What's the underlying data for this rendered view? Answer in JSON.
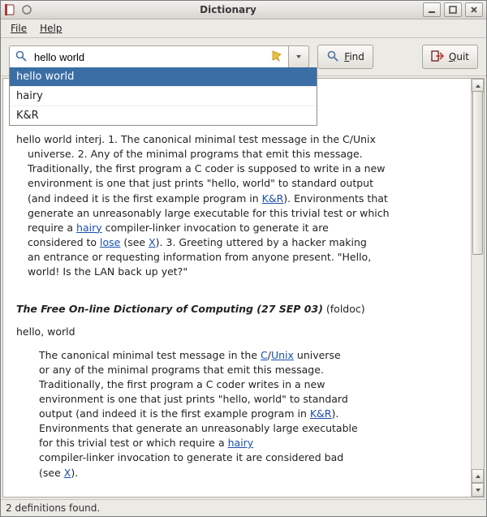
{
  "window": {
    "title": "Dictionary"
  },
  "menu": {
    "file": "File",
    "help": "Help"
  },
  "search": {
    "value": "hello world"
  },
  "buttons": {
    "find": "Find",
    "quit": "Quit"
  },
  "dropdown": {
    "items": [
      "hello world",
      "hairy",
      "K&R"
    ]
  },
  "def1": {
    "head": "hello world interj. 1. The canonical minimal test message in the C/Unix",
    "l2": "universe. 2. Any of the minimal programs that emit this message.",
    "l3": "Traditionally, the first program a C coder is supposed to write in a new",
    "l4a": "environment is one that just prints \"hello, world\" to standard output",
    "l4b": "(and indeed it is the first example program in ",
    "link_kr": "K&R",
    "l4c": "). Environments that",
    "l5": "generate an unreasonably large executable for this trivial test or which",
    "l6a": "require a ",
    "link_hairy": "hairy",
    "l6b": " compiler-linker invocation to generate it are",
    "l7a": "considered to ",
    "link_lose": "lose",
    "l7b": " (see ",
    "link_x": "X",
    "l7c": "). 3. Greeting uttered by a hacker making",
    "l8": "an entrance or requesting information from anyone present. \"Hello,",
    "l9": "world! Is the LAN back up yet?\""
  },
  "source2": {
    "title": "The Free On-line Dictionary of Computing (27 SEP 03)",
    "tag": "(foldoc)"
  },
  "def2": {
    "head": "hello, world",
    "l1a": "The canonical minimal test message in the ",
    "link_c": "C",
    "slash": "/",
    "link_unix": "Unix",
    "l1b": " universe",
    "l2": "or any of the minimal programs that emit this message.",
    "l3": "Traditionally, the first program a C coder writes in a new",
    "l4": "environment is one that just prints \"hello, world\" to standard",
    "l5a": "output (and indeed it is the first example program in ",
    "link_kr": "K&R",
    "l5b": ").",
    "l6": "Environments that generate an unreasonably large executable",
    "l7a": "for this trivial test or which require a ",
    "link_hairy": "hairy",
    "l8": "compiler-linker invocation to generate it are considered bad",
    "l9a": "(see ",
    "link_x": "X",
    "l9b": ")."
  },
  "status": {
    "text": "2 definitions found."
  }
}
